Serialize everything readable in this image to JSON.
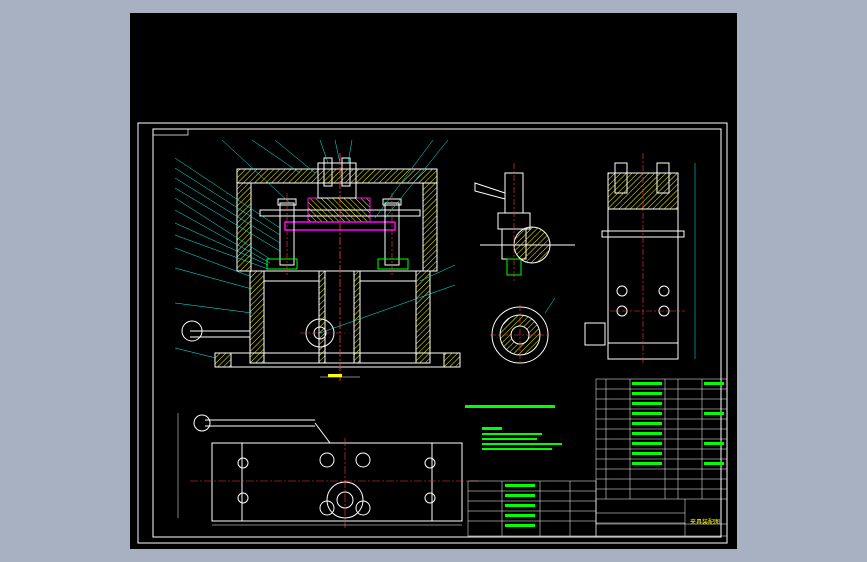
{
  "viewer": {
    "background": "#a8b1c2",
    "paper": "#000000"
  },
  "drawing": {
    "title_block_name": "夹具装配图",
    "colors": {
      "frame": "#ffffff",
      "outline": "#ffffff",
      "hatch": "#ffff00",
      "center": "#ff3b3b",
      "dimension": "#00ffff",
      "highlight": "#ff00ff",
      "parts": "#00ff00",
      "leader": "#00ffff"
    }
  }
}
